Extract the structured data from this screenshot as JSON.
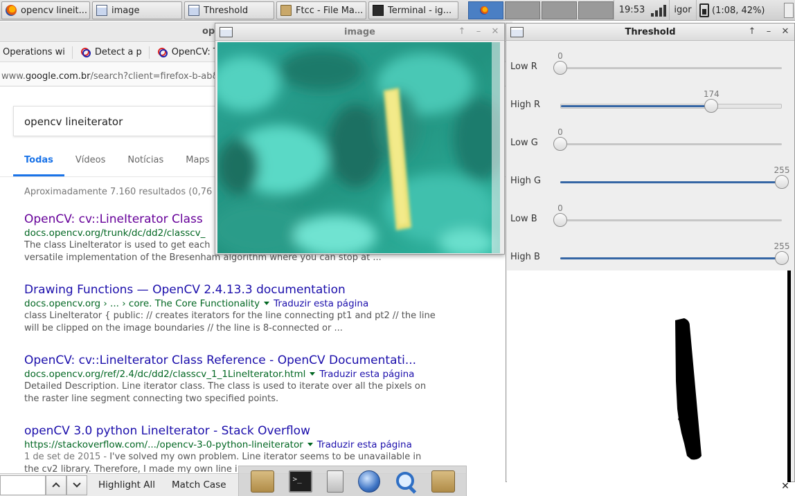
{
  "taskbar": {
    "tasks": [
      {
        "label": "opencv lineit...",
        "icon": "firefox-icon"
      },
      {
        "label": "image",
        "icon": "window-icon"
      },
      {
        "label": "Threshold",
        "icon": "window-icon"
      },
      {
        "label": "Ftcc - File Ma...",
        "icon": "folder-icon"
      },
      {
        "label": "Terminal - ig...",
        "icon": "terminal-icon"
      }
    ],
    "clock": "19:53",
    "user": "igor",
    "battery": "(1:08, 42%)"
  },
  "browser": {
    "title_fragment": "op",
    "bookmarks": [
      "Operations wi",
      "Detect a p",
      "OpenCV: T"
    ],
    "url_prefix": "www.",
    "url_domain": "google.com.br",
    "url_rest": "/search?client=firefox-b-ab&",
    "search_query": "opencv lineiterator",
    "tabs": [
      "Todas",
      "Vídeos",
      "Notícias",
      "Maps"
    ],
    "result_count": "Aproximadamente 7.160 resultados (0,76",
    "translate_label": "Traduzir esta página",
    "results": [
      {
        "title": "OpenCV: cv::LineIterator Class",
        "url": "docs.opencv.org/trunk/dc/dd2/classcv_",
        "desc_1": "The class LineIterator is used to get each",
        "desc_2": "versatile implementation of the Bresenham algorithm where you can stop at ..."
      },
      {
        "title": "Drawing Functions — OpenCV 2.4.13.3 documentation",
        "url": "docs.opencv.org › ... › core. The Core Functionality",
        "desc_1": "class LineIterator { public: // creates iterators for the line connecting pt1 and pt2 // the line",
        "desc_2": "will be clipped on the image boundaries // the line is 8-connected or ..."
      },
      {
        "title": "OpenCV: cv::LineIterator Class Reference - OpenCV Documentati...",
        "url": "docs.opencv.org/ref/2.4/dc/dd2/classcv_1_1LineIterator.html",
        "desc_1": "Detailed Description. Line iterator class. The class is used to iterate over all the pixels on",
        "desc_2": "the raster line segment connecting two specified points."
      },
      {
        "title": "openCV 3.0 python LineIterator - Stack Overflow",
        "url": "https://stackoverflow.com/.../opencv-3-0-python-lineiterator",
        "date": "1 de set de 2015 -",
        "desc_1": "I've solved my own problem. Line iterator seems to be unavailable in",
        "desc_2": "the cv2 library. Therefore, I made my own line i"
      }
    ]
  },
  "findbar": {
    "highlight_all": "Highlight All",
    "match_case": "Match Case"
  },
  "dock": {
    "icons": [
      "folder-icon",
      "terminal-icon",
      "file-cabinet-icon",
      "globe-icon",
      "search-icon",
      "folder-icon"
    ]
  },
  "image_window": {
    "title": "image"
  },
  "threshold_window": {
    "title": "Threshold",
    "trackbars": [
      {
        "label": "Low R",
        "value": 0,
        "max": 255
      },
      {
        "label": "High R",
        "value": 174,
        "max": 255
      },
      {
        "label": "Low G",
        "value": 0,
        "max": 255
      },
      {
        "label": "High G",
        "value": 255,
        "max": 255
      },
      {
        "label": "Low B",
        "value": 0,
        "max": 255
      },
      {
        "label": "High B",
        "value": 255,
        "max": 255
      }
    ]
  },
  "colors": {
    "link": "#1a0dab",
    "visited": "#660099",
    "url_green": "#006621",
    "slider_fill": "#3465a4",
    "workspace_active": "#4a7fc4"
  }
}
